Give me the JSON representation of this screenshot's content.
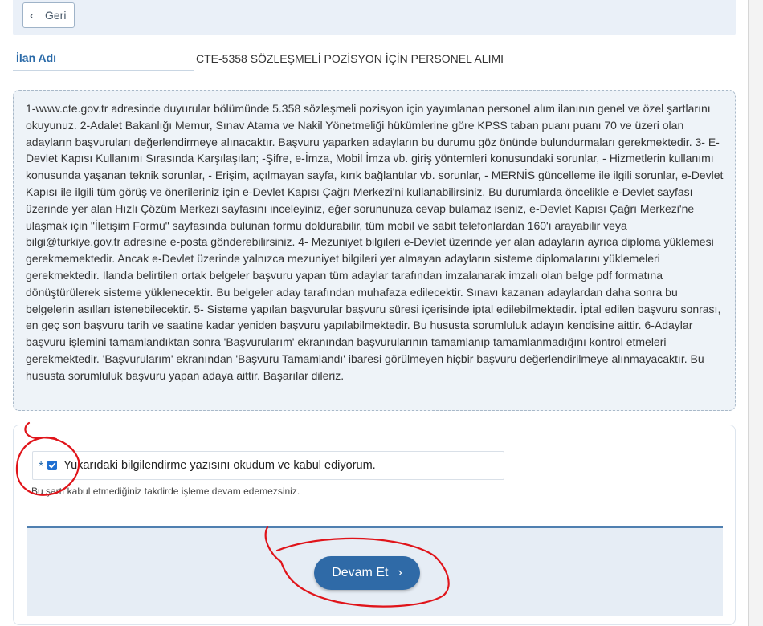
{
  "nav": {
    "back_label": "Geri"
  },
  "listing": {
    "name_label": "İlan Adı",
    "name_value": "CTE-5358 SÖZLEŞMELİ POZİSYON İÇİN PERSONEL ALIMI"
  },
  "info": {
    "text": "1-www.cte.gov.tr adresinde duyurular bölümünde 5.358 sözleşmeli pozisyon için yayımlanan personel alım ilanının genel ve özel şartlarını okuyunuz. 2-Adalet Bakanlığı Memur, Sınav Atama ve Nakil Yönetmeliği hükümlerine göre KPSS taban puanı puanı 70 ve üzeri olan adayların başvuruları değerlendirmeye alınacaktır. Başvuru yaparken adayların bu durumu göz önünde bulundurmaları gerekmektedir. 3- E-Devlet Kapısı Kullanımı Sırasında Karşılaşılan; -Şifre, e-İmza, Mobil İmza vb. giriş yöntemleri konusundaki sorunlar, - Hizmetlerin kullanımı konusunda yaşanan teknik sorunlar, - Erişim, açılmayan sayfa, kırık bağlantılar vb. sorunlar, - MERNİS güncelleme ile ilgili sorunlar, e-Devlet Kapısı ile ilgili tüm görüş ve önerileriniz için e-Devlet Kapısı Çağrı Merkezi'ni kullanabilirsiniz. Bu durumlarda öncelikle e-Devlet sayfası üzerinde yer alan Hızlı Çözüm Merkezi sayfasını inceleyiniz, eğer sorununuza cevap bulamaz iseniz, e-Devlet Kapısı Çağrı Merkezi'ne ulaşmak için \"İletişim Formu\" sayfasında bulunan formu doldurabilir, tüm mobil ve sabit telefonlardan 160'ı arayabilir veya bilgi@turkiye.gov.tr adresine e-posta gönderebilirsiniz. 4- Mezuniyet bilgileri e-Devlet üzerinde yer alan adayların ayrıca diploma yüklemesi gerekmemektedir. Ancak e-Devlet üzerinde yalnızca mezuniyet bilgileri yer almayan adayların sisteme diplomalarını yüklemeleri gerekmektedir. İlanda belirtilen ortak belgeler başvuru yapan tüm adaylar tarafından imzalanarak imzalı olan belge pdf formatına dönüştürülerek sisteme yüklenecektir. Bu belgeler aday tarafından muhafaza edilecektir. Sınavı kazanan adaylardan daha sonra bu belgelerin asılları istenebilecektir. 5- Sisteme yapılan başvurular başvuru süresi içerisinde iptal edilebilmektedir. İptal edilen başvuru sonrası, en geç son başvuru tarih ve saatine kadar yeniden başvuru yapılabilmektedir. Bu hususta sorumluluk adayın kendisine aittir. 6-Adaylar başvuru işlemini tamamlandıktan sonra 'Başvurularım' ekranından başvurularının tamamlanıp tamamlanmadığını kontrol etmeleri gerekmektedir. 'Başvurularım' ekranından 'Başvuru Tamamlandı' ibaresi görülmeyen hiçbir başvuru değerlendirilmeye alınmayacaktır. Bu hususta sorumluluk başvuru yapan adaya aittir. Başarılar dileriz."
  },
  "consent": {
    "required_mark": "*",
    "checked": true,
    "label": "Yukarıdaki bilgilendirme yazısını okudum ve kabul ediyorum.",
    "helper": "Bu şartı kabul etmediğiniz takdirde işleme devam edemezsiniz."
  },
  "actions": {
    "continue_label": "Devam Et"
  },
  "colors": {
    "primary": "#2f6aa7",
    "label_blue": "#2a6aa8",
    "checkbox": "#1f6fd1",
    "annotation_red": "#e0141a"
  },
  "icons": {
    "back": "chevron-left-icon",
    "continue": "chevron-right-icon",
    "check": "check-icon"
  }
}
